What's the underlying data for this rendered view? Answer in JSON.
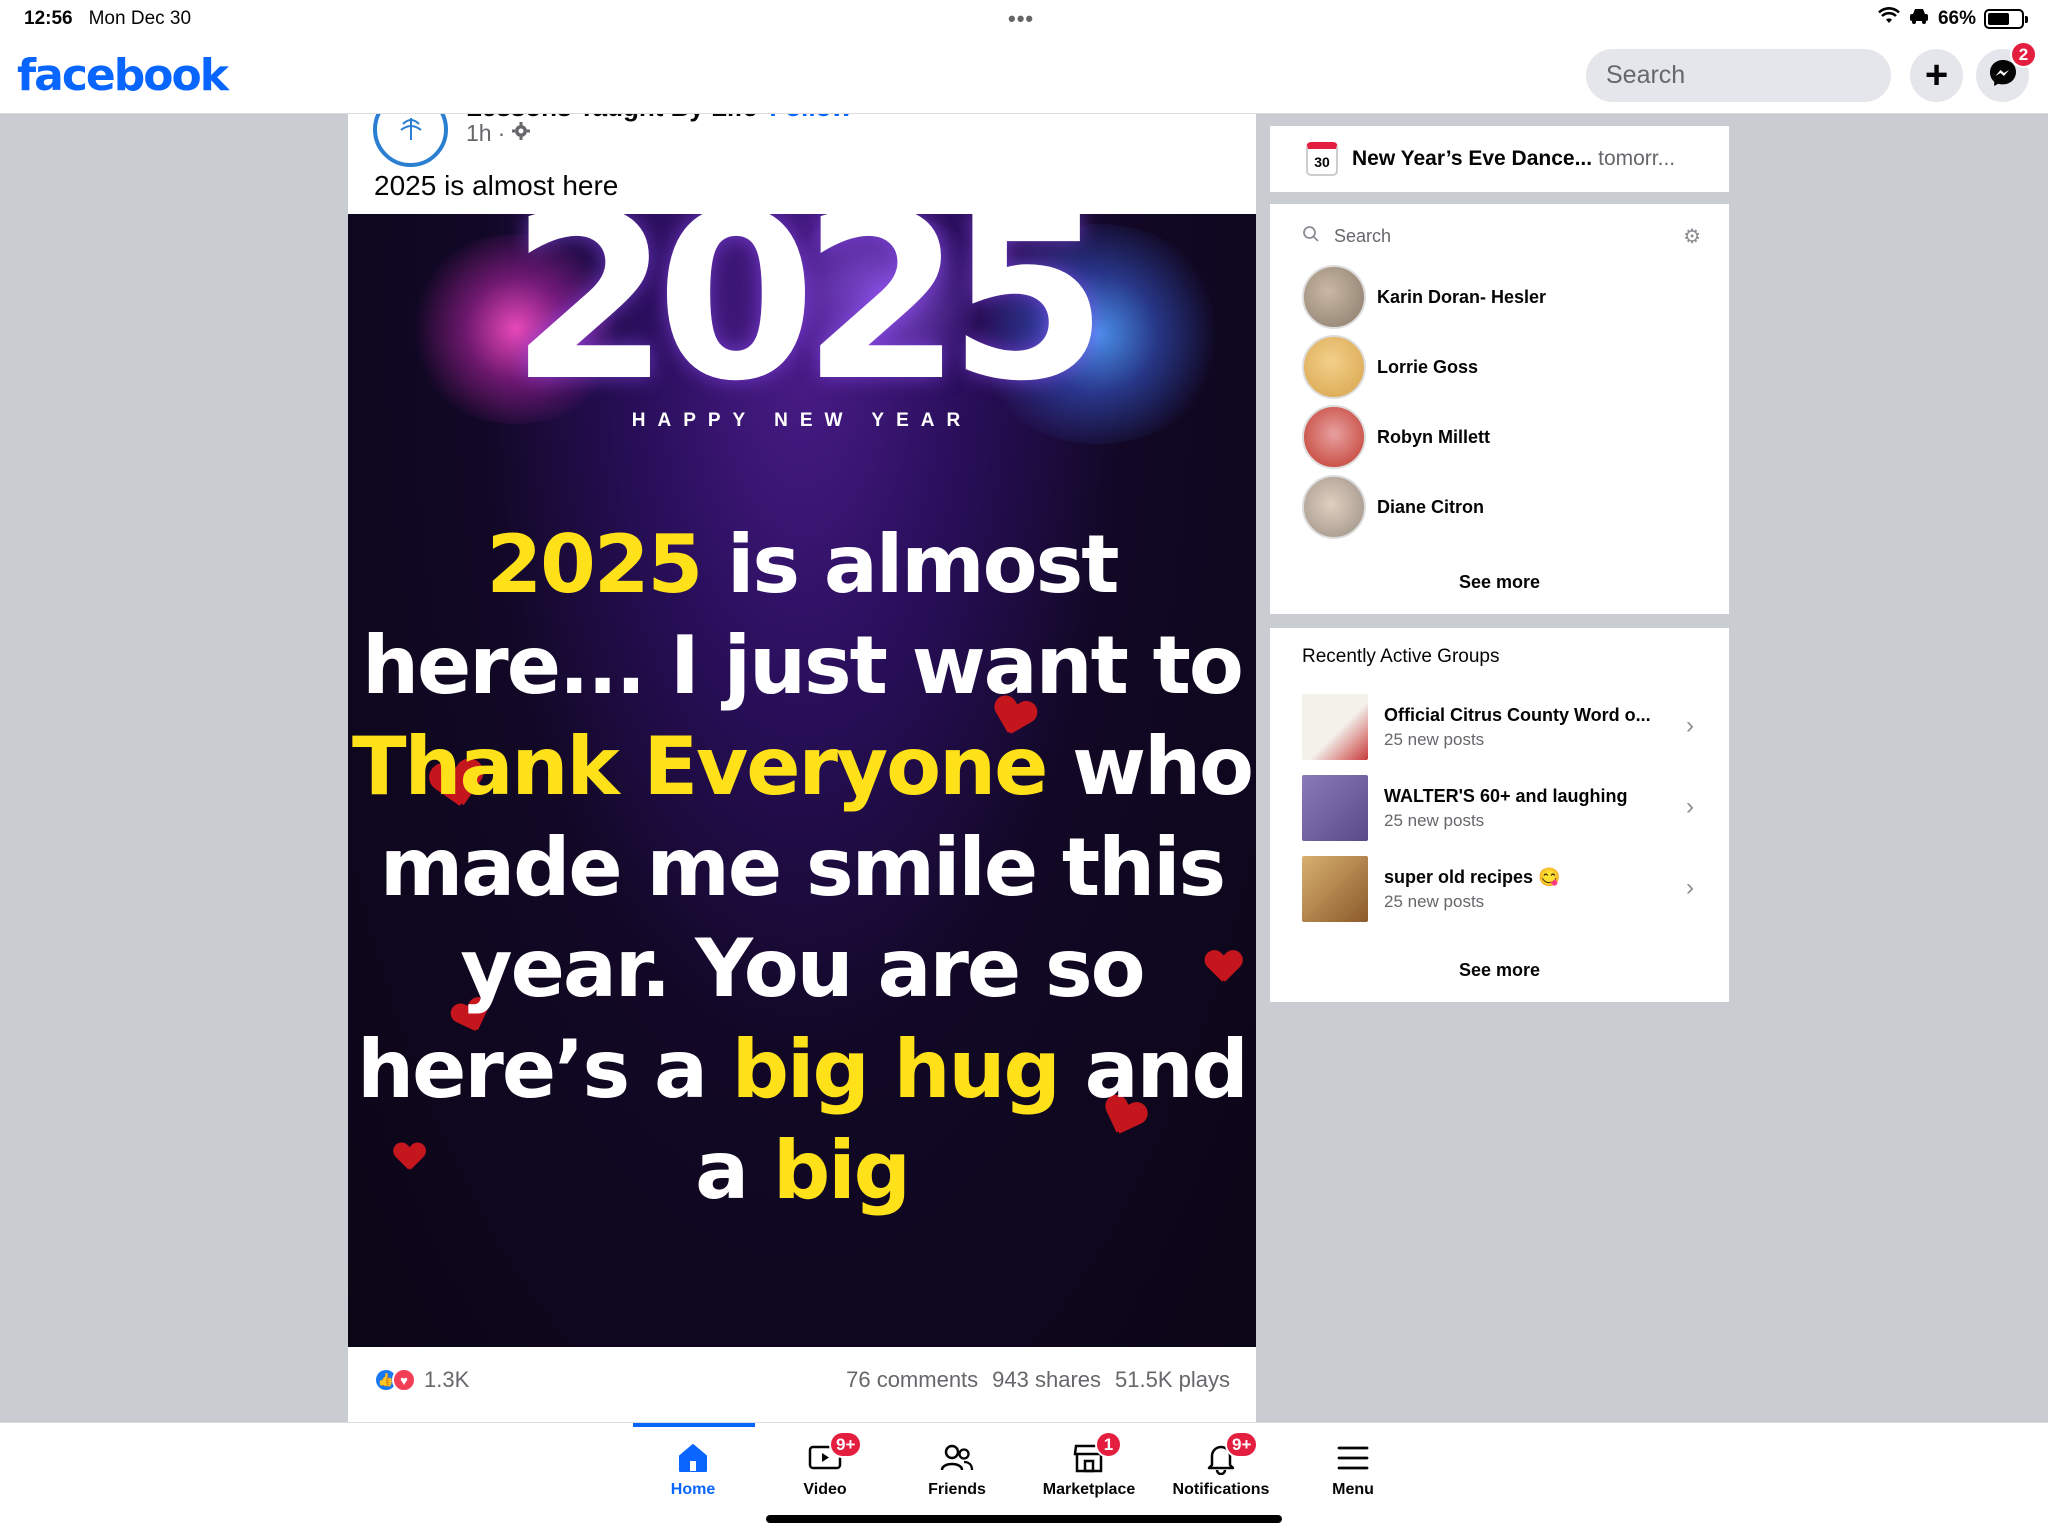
{
  "status_bar": {
    "time": "12:56",
    "date": "Mon Dec 30",
    "battery": "66%",
    "battery_level": 0.66
  },
  "topnav": {
    "logo": "facebook",
    "search_placeholder": "Search",
    "messenger_badge": "2"
  },
  "post": {
    "author": "Lessons Taught By Life",
    "follow_label": "Follow",
    "time": "1h",
    "text": "2025 is almost here",
    "image": {
      "year": "2025",
      "subtitle": "HAPPY NEW YEAR",
      "message_parts": [
        {
          "text": "2025",
          "highlight": true
        },
        {
          "text": " is almost here... I just want to ",
          "highlight": false
        },
        {
          "text": "Thank Everyone",
          "highlight": true
        },
        {
          "text": " who made me smile this year. You are so here’s a ",
          "highlight": false
        },
        {
          "text": "big hug",
          "highlight": true
        },
        {
          "text": " and a ",
          "highlight": false
        },
        {
          "text": "big",
          "highlight": true
        }
      ]
    },
    "reactions_count": "1.3K",
    "comments": "76 comments",
    "shares": "943 shares",
    "plays": "51.5K plays"
  },
  "event": {
    "day": "30",
    "title": "New Year’s Eve Dance...",
    "when": "tomorr..."
  },
  "contacts": {
    "search_placeholder": "Search",
    "items": [
      {
        "name": "Karin Doran- Hesler",
        "color": "#8a7a6a"
      },
      {
        "name": "Lorrie Goss",
        "color": "#d7a24a"
      },
      {
        "name": "Robyn Millett",
        "color": "#c0392b"
      },
      {
        "name": "Diane Citron",
        "color": "#9a8f84"
      }
    ],
    "see_more": "See more"
  },
  "groups": {
    "title": "Recently Active Groups",
    "items": [
      {
        "name": "Official Citrus County Word o...",
        "sub": "25 new posts",
        "color": "#c73a3a"
      },
      {
        "name": "WALTER'S 60+ and laughing",
        "sub": "25 new posts",
        "color": "#5a4a8a"
      },
      {
        "name": "super old recipes 😋",
        "sub": "25 new posts",
        "color": "#b5803a"
      }
    ],
    "see_more": "See more"
  },
  "tabbar": {
    "items": [
      {
        "label": "Home",
        "badge": ""
      },
      {
        "label": "Video",
        "badge": "9+"
      },
      {
        "label": "Friends",
        "badge": ""
      },
      {
        "label": "Marketplace",
        "badge": "1"
      },
      {
        "label": "Notifications",
        "badge": "9+"
      },
      {
        "label": "Menu",
        "badge": ""
      }
    ]
  },
  "colors": {
    "brand": "#0866ff",
    "badge": "#e41e3f",
    "highlight_text": "#ffe11a"
  }
}
